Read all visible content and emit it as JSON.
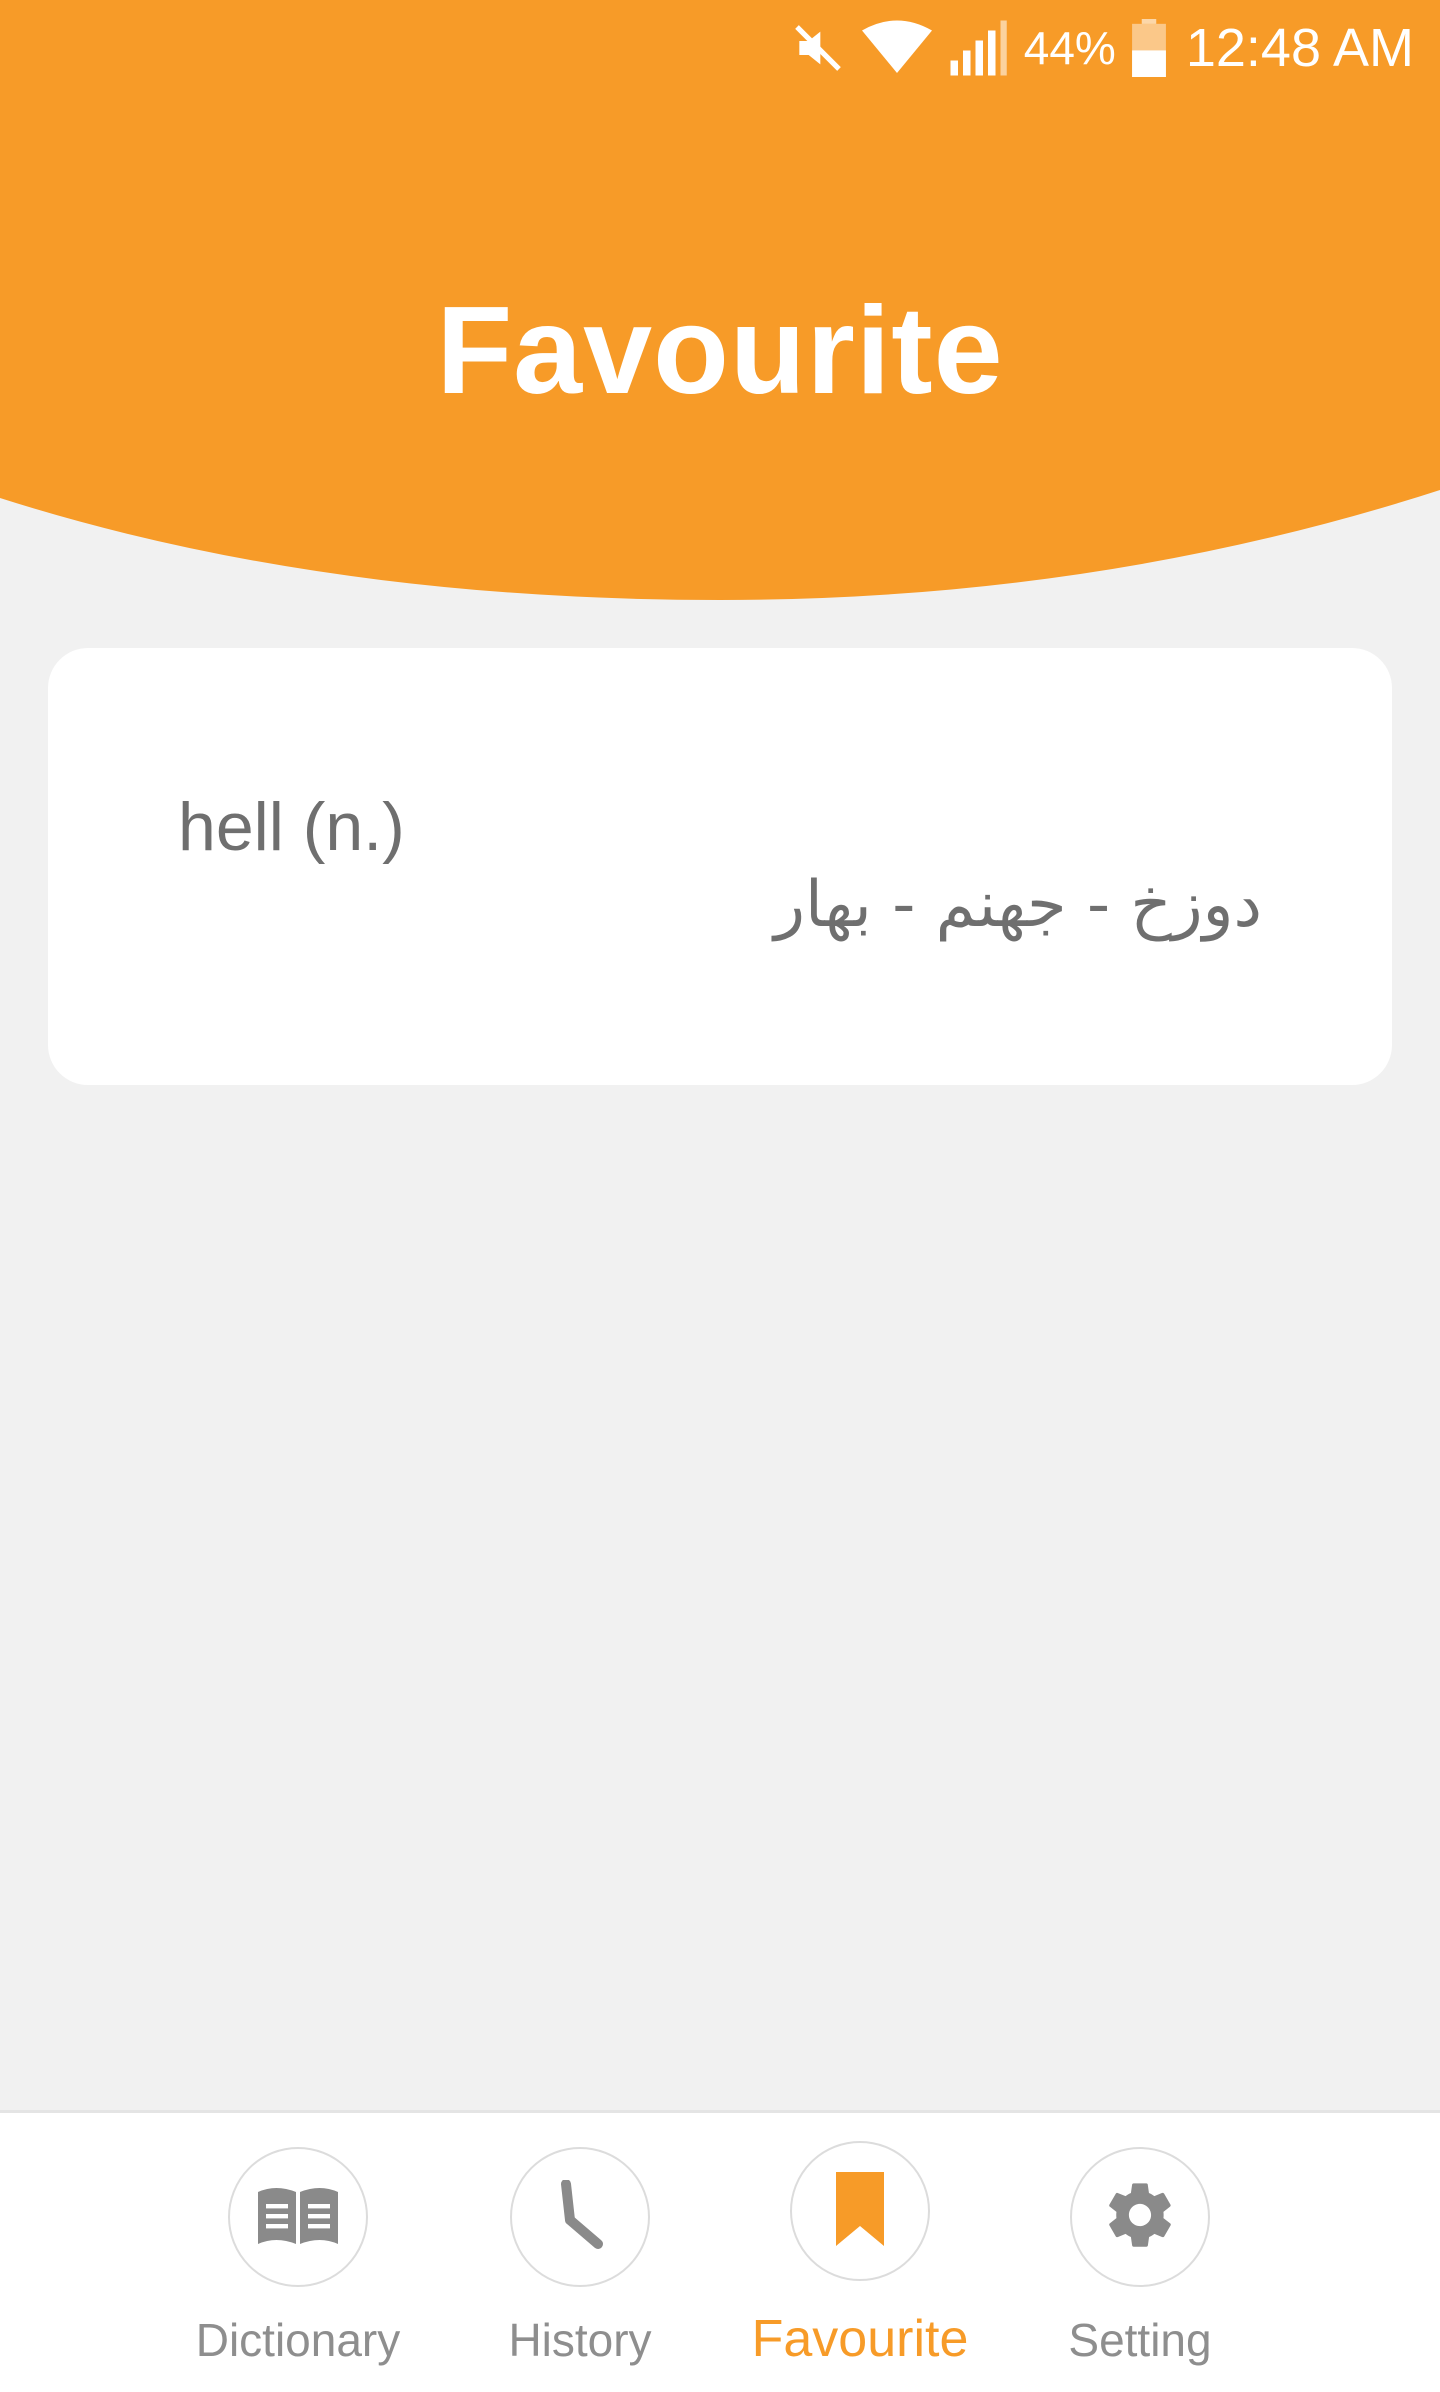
{
  "status_bar": {
    "battery_percent": "44%",
    "time": "12:48 AM",
    "icons": [
      "mute-icon",
      "wifi-icon",
      "signal-icon",
      "battery-icon"
    ]
  },
  "header": {
    "title": "Favourite",
    "color": "#F79B28"
  },
  "favourites": [
    {
      "word": "hell (n.)",
      "meaning": "دوزخ - جهنم - بهار"
    }
  ],
  "bottom_nav": {
    "items": [
      {
        "label": "Dictionary",
        "icon": "book-icon",
        "active": false
      },
      {
        "label": "History",
        "icon": "clock-icon",
        "active": false
      },
      {
        "label": "Favourite",
        "icon": "bookmark-icon",
        "active": true
      },
      {
        "label": "Setting",
        "icon": "gear-icon",
        "active": false
      }
    ],
    "active_color": "#F79B28",
    "inactive_color": "#8e8e8e"
  }
}
